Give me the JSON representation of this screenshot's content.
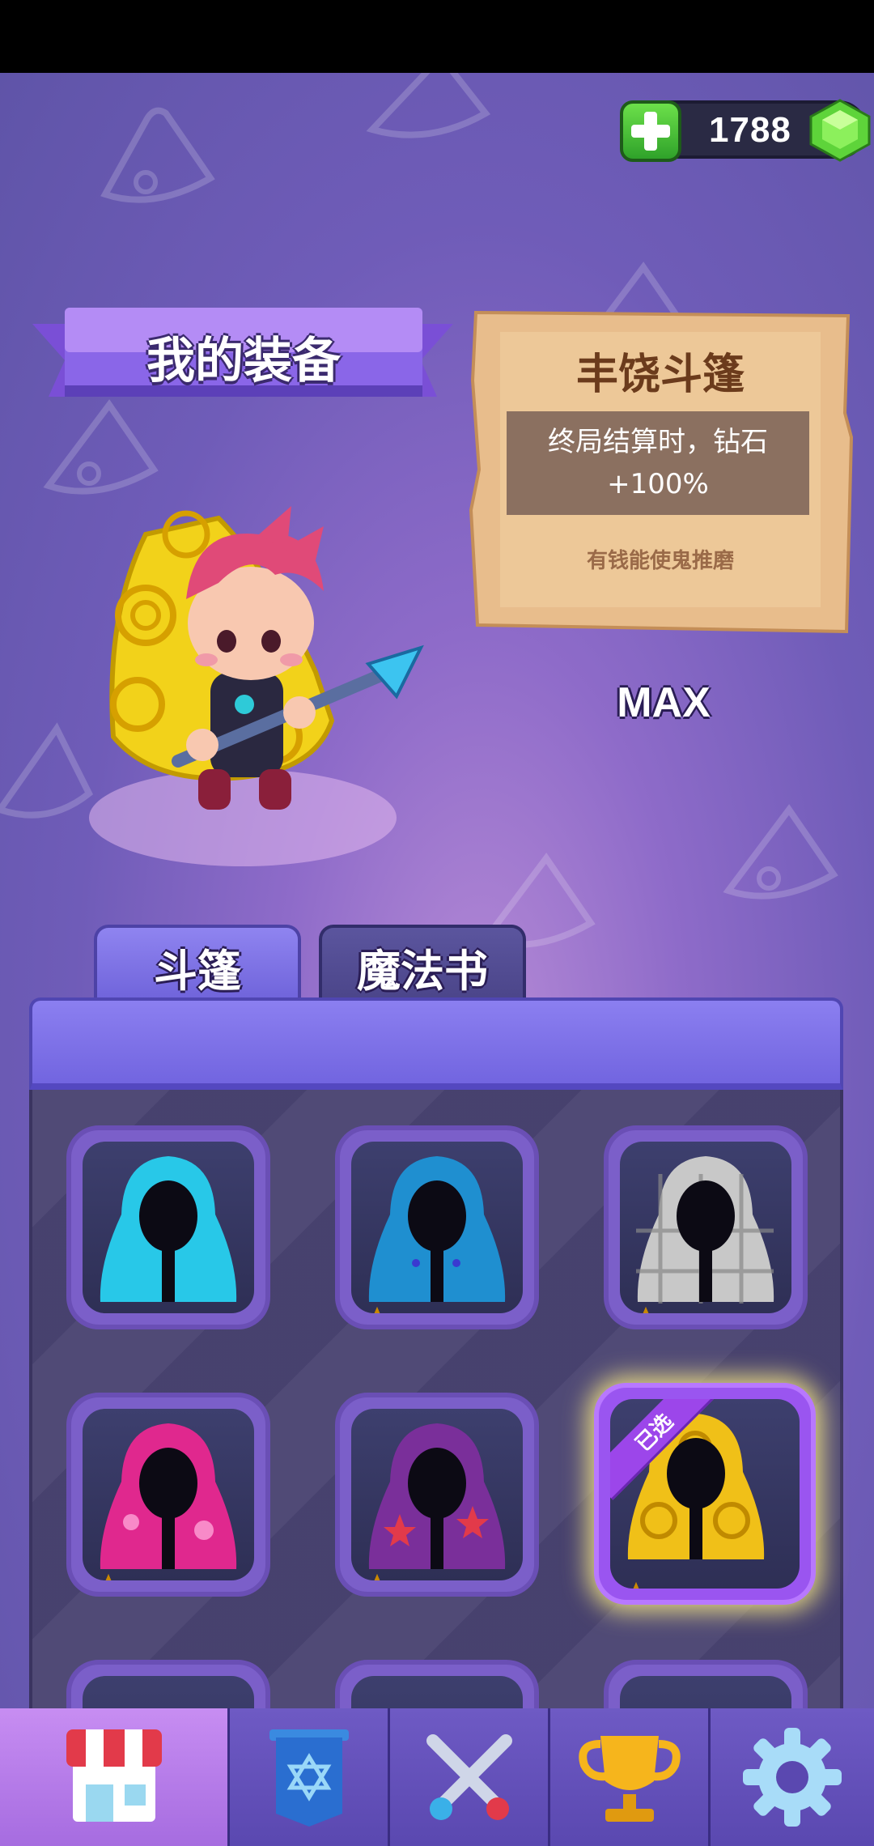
{
  "currency": {
    "amount": "1788",
    "icon": "green-gem-icon",
    "add_icon": "plus-icon"
  },
  "title": "我的装备",
  "equipped": {
    "name": "丰饶斗篷",
    "effect": "终局结算时，钻石+100%",
    "flavor": "有钱能使鬼推磨",
    "level": "MAX"
  },
  "tabs": [
    {
      "label": "斗篷",
      "active": true
    },
    {
      "label": "魔法书",
      "active": false
    }
  ],
  "items": [
    {
      "color": "#28c8e8",
      "stars": 0,
      "pattern": "plain"
    },
    {
      "color": "#1f8fd0",
      "stars": 3,
      "pattern": "dots"
    },
    {
      "color": "#c8c8c8",
      "stars": 3,
      "pattern": "plaid"
    },
    {
      "color": "#e0288e",
      "stars": 3,
      "pattern": "hearts"
    },
    {
      "color": "#7a2f9a",
      "stars": 3,
      "pattern": "stars"
    },
    {
      "color": "#f0c018",
      "stars": 3,
      "pattern": "spirals",
      "selected": true,
      "tag": "已选"
    }
  ],
  "nav": [
    {
      "name": "shop-icon",
      "active": true
    },
    {
      "name": "banner-icon",
      "active": false
    },
    {
      "name": "crossed-swords-icon",
      "active": false
    },
    {
      "name": "trophy-icon",
      "active": false
    },
    {
      "name": "gear-icon",
      "active": false
    }
  ]
}
